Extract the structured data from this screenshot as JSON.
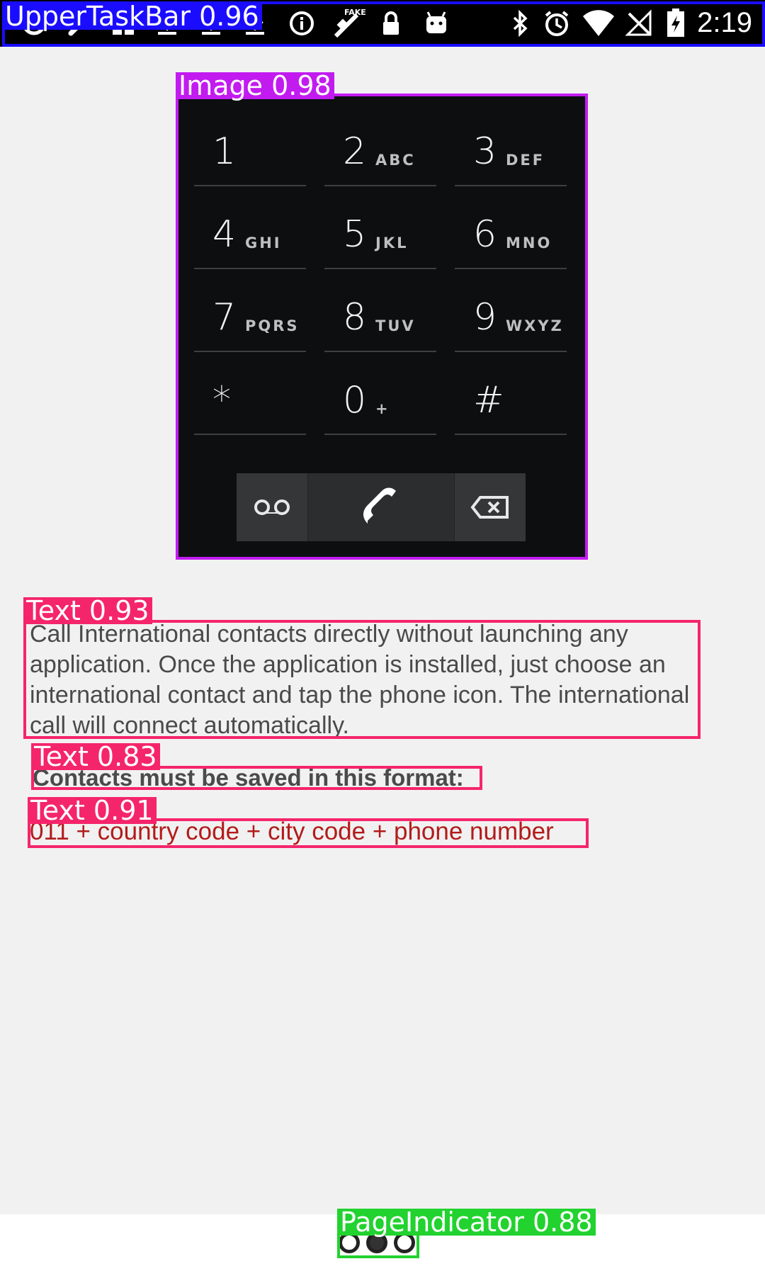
{
  "status_bar": {
    "left_icons": [
      "settings-icon",
      "wrench-icon",
      "gift-icon",
      "download-icon",
      "download-icon",
      "download-icon",
      "info-icon",
      "satellite-fake-gps-icon",
      "lock-icon",
      "android-icon"
    ],
    "right_icons": [
      "bluetooth-icon",
      "alarm-icon",
      "wifi-icon",
      "no-signal-icon",
      "battery-charging-icon"
    ],
    "fake_gps_badge": "FAKE",
    "time": "2:19"
  },
  "dialer": {
    "keys": [
      {
        "digit": "1",
        "letters": ""
      },
      {
        "digit": "2",
        "letters": "ABC"
      },
      {
        "digit": "3",
        "letters": "DEF"
      },
      {
        "digit": "4",
        "letters": "GHI"
      },
      {
        "digit": "5",
        "letters": "JKL"
      },
      {
        "digit": "6",
        "letters": "MNO"
      },
      {
        "digit": "7",
        "letters": "PQRS"
      },
      {
        "digit": "8",
        "letters": "TUV"
      },
      {
        "digit": "9",
        "letters": "WXYZ"
      },
      {
        "digit": "*",
        "letters": ""
      },
      {
        "digit": "0",
        "letters": "+"
      },
      {
        "digit": "#",
        "letters": ""
      }
    ],
    "actions": [
      "voicemail-icon",
      "phone-icon",
      "backspace-icon"
    ]
  },
  "content": {
    "description": "Call International contacts directly without launching any application. Once the application is installed, just choose an international contact and tap the phone icon. The international call will connect automatically.",
    "format_label": "Contacts must be saved in this format:",
    "format_value": "011 + country code + city code + phone number"
  },
  "page_indicator": {
    "count": 3,
    "active_index": 1
  },
  "detections": [
    {
      "label": "UpperTaskBar  0.96",
      "color": "#1a0dff"
    },
    {
      "label": "Image  0.98",
      "color": "#c21bf0"
    },
    {
      "label": "Text  0.93",
      "color": "#f5256b"
    },
    {
      "label": "Text  0.83",
      "color": "#f5256b"
    },
    {
      "label": "Text  0.91",
      "color": "#f5256b"
    },
    {
      "label": "PageIndicator  0.88",
      "color": "#22d22f"
    }
  ]
}
